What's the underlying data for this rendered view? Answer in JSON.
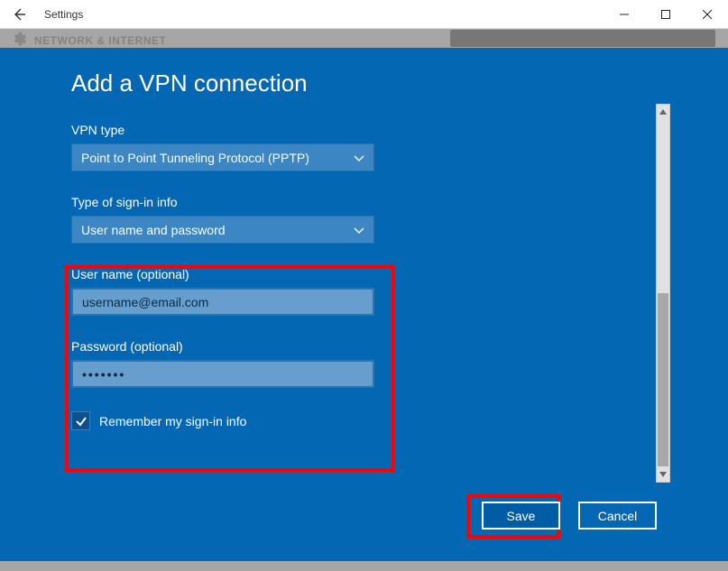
{
  "window": {
    "title": "Settings"
  },
  "strip": {
    "heading": "NETWORK & INTERNET"
  },
  "dialog": {
    "title": "Add a VPN connection",
    "vpn_type": {
      "label": "VPN type",
      "value": "Point to Point Tunneling Protocol (PPTP)"
    },
    "signin_type": {
      "label": "Type of sign-in info",
      "value": "User name and password"
    },
    "username": {
      "label": "User name (optional)",
      "value": "username@email.com"
    },
    "password": {
      "label": "Password (optional)",
      "value": "•••••••"
    },
    "remember": {
      "label": "Remember my sign-in info",
      "checked": true
    },
    "buttons": {
      "save": "Save",
      "cancel": "Cancel"
    }
  }
}
